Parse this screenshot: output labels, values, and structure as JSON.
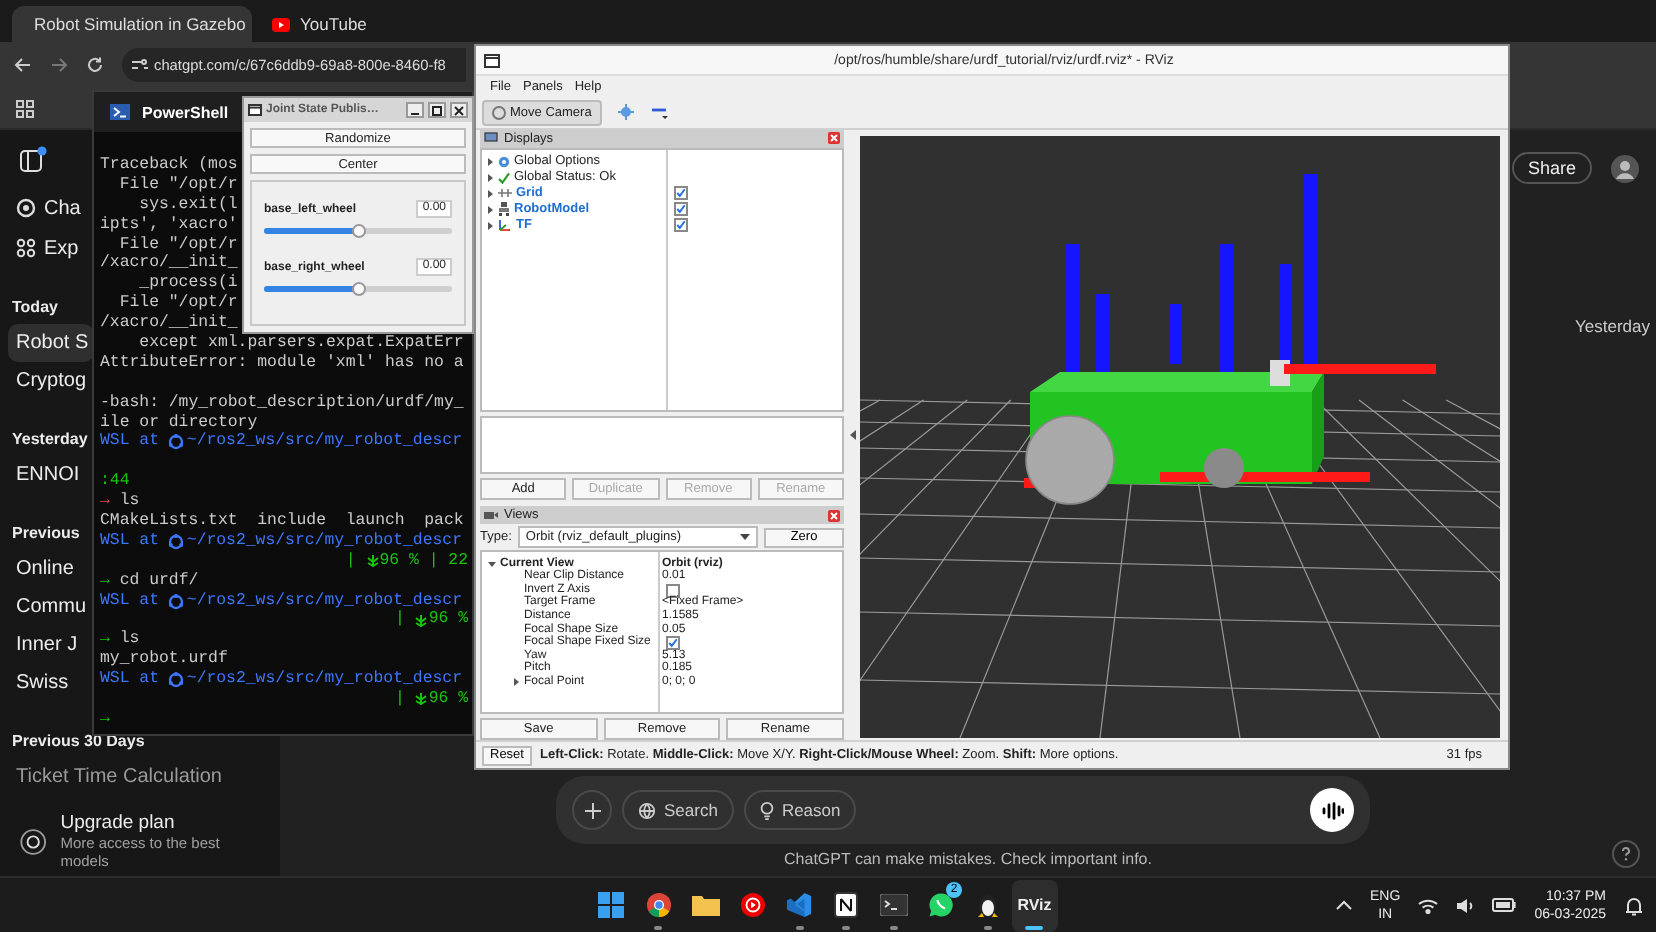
{
  "browser": {
    "tabs": [
      {
        "title": "Robot Simulation in Gazebo",
        "kind": "page",
        "selected": true
      },
      {
        "title": "YouTube",
        "kind": "video",
        "selected": false
      }
    ],
    "address": "chatgpt.com/c/67c6ddb9-69a8-800e-8460-f8"
  },
  "sidebar": {
    "nav": [
      {
        "label": "Cha",
        "kind": "chatgpt"
      },
      {
        "label": "Exp",
        "kind": "explore"
      }
    ],
    "sections": [
      {
        "heading": "Today",
        "chats": [
          {
            "title": "Robot S",
            "selected": true
          },
          {
            "title": "Cryptog",
            "selected": false
          }
        ]
      },
      {
        "heading": "Yesterday",
        "chats": [
          {
            "title": "ENNOI",
            "selected": false
          }
        ]
      },
      {
        "heading": "Previous",
        "chats": [
          {
            "title": "Online",
            "selected": false
          },
          {
            "title": "Commu",
            "selected": false
          },
          {
            "title": "Inner J",
            "selected": false
          },
          {
            "title": "Swiss",
            "selected": false
          }
        ]
      },
      {
        "heading": "Previous 30 Days",
        "chats": [
          {
            "title": "Ticket Time Calculation",
            "selected": false
          }
        ]
      }
    ],
    "upgrade": {
      "title": "Upgrade plan",
      "subtitle": "More access to the best models"
    }
  },
  "chat": {
    "share": "Share",
    "side_label": "Yesterday",
    "tools": [
      {
        "label": "Search",
        "kind": "search"
      },
      {
        "label": "Reason",
        "kind": "reason"
      }
    ],
    "disclaimer": "ChatGPT can make mistakes. Check important info."
  },
  "terminal": {
    "title": "PowerShell",
    "lines": [
      {
        "kind": "plain",
        "text": "Traceback (mos"
      },
      {
        "kind": "plain",
        "text": "  File \"/opt/r"
      },
      {
        "kind": "plain",
        "text": "    sys.exit(l"
      },
      {
        "kind": "plain",
        "text": "ipts', 'xacro'"
      },
      {
        "kind": "plain",
        "text": "  File \"/opt/r"
      },
      {
        "kind": "plain",
        "text": "/xacro/__init_"
      },
      {
        "kind": "plain",
        "text": "    _process(i"
      },
      {
        "kind": "plain",
        "text": "  File \"/opt/r"
      },
      {
        "kind": "plain",
        "text": "/xacro/__init_"
      },
      {
        "kind": "plain",
        "text": "    except xml.parsers.expat.ExpatErr"
      },
      {
        "kind": "plain",
        "text": "AttributeError: module 'xml' has no a"
      },
      {
        "kind": "blank"
      },
      {
        "kind": "plain",
        "text": "-bash: /my_robot_description/urdf/my_"
      },
      {
        "kind": "plain",
        "text": "ile or directory"
      },
      {
        "kind": "prompt",
        "prefix": "WSL at",
        "path": "~/ros2_ws/src/my_robot_descr"
      },
      {
        "kind": "blank"
      },
      {
        "kind": "green",
        "text": ":44"
      },
      {
        "kind": "command",
        "arrow": "→",
        "command": "ls",
        "ok": false
      },
      {
        "kind": "plain",
        "text": "CMakeLists.txt  include  launch  pack"
      },
      {
        "kind": "prompt",
        "prefix": "WSL at",
        "path": "~/ros2_ws/src/my_robot_descr"
      },
      {
        "kind": "status",
        "parts": [
          "|",
          "96 %",
          "| 22"
        ]
      },
      {
        "kind": "command",
        "arrow": "→",
        "command": "cd urdf/",
        "ok": true
      },
      {
        "kind": "prompt",
        "prefix": "WSL at",
        "path": "~/ros2_ws/src/my_robot_descr"
      },
      {
        "kind": "status",
        "parts": [
          "|",
          "96 %"
        ]
      },
      {
        "kind": "command",
        "arrow": "→",
        "command": "ls",
        "ok": true
      },
      {
        "kind": "plain",
        "text": "my_robot.urdf"
      },
      {
        "kind": "prompt",
        "prefix": "WSL at",
        "path": "~/ros2_ws/src/my_robot_descr"
      },
      {
        "kind": "status",
        "parts": [
          "|",
          "96 %"
        ]
      },
      {
        "kind": "command",
        "arrow": "→",
        "ok": true
      }
    ]
  },
  "joint_state_publisher": {
    "title": "Joint State Publis…",
    "buttons": [
      "Randomize",
      "Center"
    ],
    "joints": [
      {
        "name": "base_left_wheel",
        "value": "0.00",
        "level": 0.5
      },
      {
        "name": "base_right_wheel",
        "value": "0.00",
        "level": 0.5
      }
    ]
  },
  "rviz": {
    "title": "/opt/ros/humble/share/urdf_tutorial/rviz/urdf.rviz* - RViz",
    "menu": [
      "File",
      "Panels",
      "Help"
    ],
    "move_camera": "Move Camera",
    "displays": {
      "title": "Displays",
      "items": [
        {
          "label": "Global Options",
          "kind": "options"
        },
        {
          "label": "Global Status: Ok",
          "kind": "status"
        },
        {
          "label": "Grid",
          "kind": "grid",
          "checked": true
        },
        {
          "label": "RobotModel",
          "kind": "robot_model",
          "checked": true
        },
        {
          "label": "TF",
          "kind": "tf",
          "checked": true
        }
      ],
      "buttons": [
        {
          "label": "Add",
          "disabled": false
        },
        {
          "label": "Duplicate",
          "disabled": true
        },
        {
          "label": "Remove",
          "disabled": true
        },
        {
          "label": "Rename",
          "disabled": true
        }
      ]
    },
    "views": {
      "title": "Views",
      "type_label": "Type:",
      "type_value": "Orbit (rviz_default_plugins)",
      "zero": "Zero",
      "properties": [
        {
          "name": "Current View",
          "value": "Orbit (rviz)",
          "kind": "header",
          "expanded": true,
          "children": [
            {
              "name": "Near Clip Distance",
              "kind": "text",
              "value": "0.01"
            },
            {
              "name": "Invert Z Axis",
              "kind": "checkbox",
              "checked": false
            },
            {
              "name": "Target Frame",
              "kind": "text",
              "value": "<Fixed Frame>"
            },
            {
              "name": "Distance",
              "kind": "text",
              "value": "1.1585"
            },
            {
              "name": "Focal Shape Size",
              "kind": "text",
              "value": "0.05"
            },
            {
              "name": "Focal Shape Fixed Size",
              "kind": "checkbox",
              "checked": true
            },
            {
              "name": "Yaw",
              "kind": "text",
              "value": "5.13"
            },
            {
              "name": "Pitch",
              "kind": "text",
              "value": "0.185"
            },
            {
              "name": "Focal Point",
              "kind": "text",
              "value": "0; 0; 0",
              "expanded": false
            }
          ]
        }
      ],
      "buttons": [
        "Save",
        "Remove",
        "Rename"
      ]
    },
    "status": {
      "reset": "Reset",
      "help": "**Left-Click:** Rotate. **Middle-Click:** Move X/Y. **Right-Click/Mouse Wheel:** Zoom. **Shift:** More options.",
      "fps": "31 fps"
    }
  },
  "taskbar": {
    "apps": [
      {
        "kind": "start",
        "running": false,
        "selected": false
      },
      {
        "kind": "browser",
        "running": true,
        "selected": false
      },
      {
        "kind": "files",
        "running": false,
        "selected": false
      },
      {
        "kind": "music",
        "running": false,
        "selected": false
      },
      {
        "kind": "code",
        "running": true,
        "selected": false
      },
      {
        "kind": "notes",
        "running": true,
        "selected": false
      },
      {
        "kind": "terminal",
        "running": true,
        "selected": false
      },
      {
        "kind": "chat",
        "running": false,
        "selected": false,
        "badge": "2"
      },
      {
        "kind": "penguin",
        "running": true,
        "selected": false
      },
      {
        "kind": "rviz",
        "running": true,
        "selected": true,
        "label": "RViz"
      }
    ],
    "lang": "ENG",
    "region": "IN",
    "time": "10:37 PM",
    "date": "06-03-2025"
  }
}
